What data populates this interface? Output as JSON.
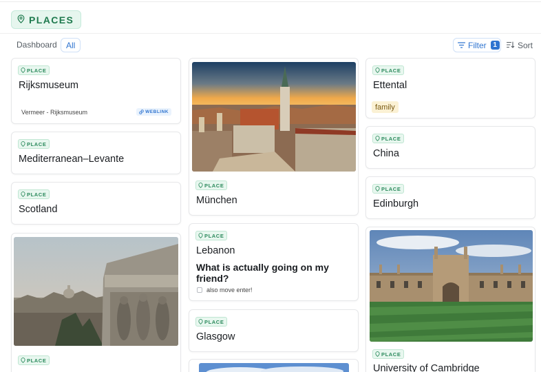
{
  "header": {
    "title": "PLACES"
  },
  "toolbar": {
    "breadcrumb": "Dashboard",
    "view_chip": "All",
    "filter_label": "Filter",
    "filter_count": "1",
    "sort_label": "Sort"
  },
  "cards": {
    "rijksmuseum": {
      "badge": "PLACE",
      "title": "Rijksmuseum",
      "link_text": "Vermeer - Rijksmuseum",
      "link_badge": "WEBLINK"
    },
    "mediterranean": {
      "badge": "PLACE",
      "title": "Mediterranean–Levante"
    },
    "scotland": {
      "badge": "PLACE",
      "title": "Scotland"
    },
    "rome": {
      "badge": "PLACE"
    },
    "munchen": {
      "badge": "PLACE",
      "title": "München"
    },
    "lebanon": {
      "badge": "PLACE",
      "title": "Lebanon",
      "question": "What is actually going on my friend?",
      "todo": "also move enter!"
    },
    "glasgow": {
      "badge": "PLACE",
      "title": "Glasgow"
    },
    "ettental": {
      "badge": "PLACE",
      "title": "Ettental",
      "tag": "family"
    },
    "china": {
      "badge": "PLACE",
      "title": "China"
    },
    "edinburgh": {
      "badge": "PLACE",
      "title": "Edinburgh"
    },
    "cambridge": {
      "badge": "PLACE",
      "title": "University of Cambridge"
    }
  },
  "colors": {
    "accent_green": "#2b8a5c",
    "accent_blue": "#2f74d0",
    "tag_yellow": "#fbf1d4"
  },
  "icons": [
    "map-pin-icon",
    "filter-icon",
    "sort-icon",
    "link-icon"
  ]
}
